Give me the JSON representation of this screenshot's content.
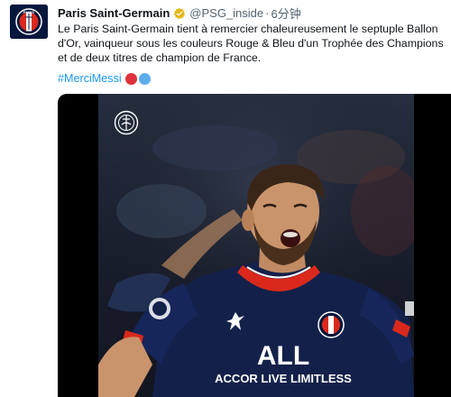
{
  "tweet": {
    "author_name": "Paris Saint-Germain",
    "handle": "@PSG_inside",
    "separator": "·",
    "time": "6分钟",
    "text": "Le Paris Saint-Germain tient à remercier chaleureusement le septuple Ballon d'Or, vainqueur sous les couleurs Rouge & Bleu d'un Trophée des Champions et de deux titres de champion de France.",
    "hashtag": "#MerciMessi",
    "avatar_icon": "psg-crest-icon",
    "verified_icon": "verified-badge-icon",
    "more_icon": "more-options-icon"
  },
  "media": {
    "watermark_icon": "psg-crest-icon",
    "jersey_sponsor": "ALL ACCOR LIVE LIMITLESS",
    "jersey_crest": "PSG"
  },
  "colors": {
    "psg_navy": "#05173d",
    "psg_red": "#da291c",
    "link_blue": "#1d9bf0",
    "verified_gold": "#e2b719",
    "emoji_red": "#e0323c",
    "emoji_blue": "#5dadec"
  }
}
